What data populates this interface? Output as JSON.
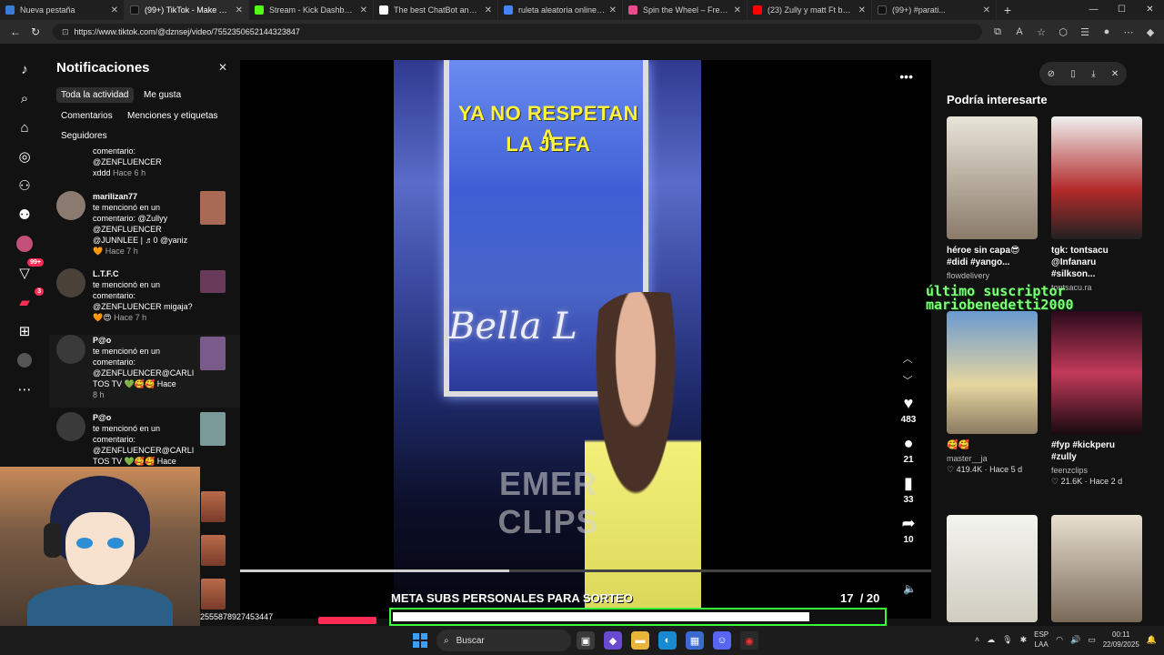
{
  "browser": {
    "tabs": [
      {
        "title": "Nueva pestaña",
        "color": "#3a7bd5",
        "active": false
      },
      {
        "title": "(99+) TikTok - Make Your Day",
        "color": "#111111",
        "active": true
      },
      {
        "title": "Stream - Kick Dashboard",
        "color": "#53fc18",
        "active": false
      },
      {
        "title": "The best ChatBot and Widg...",
        "color": "#ffffff",
        "active": false
      },
      {
        "title": "ruleta aleatoria online - Bú...",
        "color": "#4285f4",
        "active": false
      },
      {
        "title": "Spin the Wheel – Free and...",
        "color": "#e94b8a",
        "active": false
      },
      {
        "title": "(23) Zully y matt Ft baile in...",
        "color": "#ff0000",
        "active": false
      },
      {
        "title": "(99+) #parati...",
        "color": "#111111",
        "active": false
      }
    ],
    "url": "https://www.tiktok.com/@dznsej/video/7552350652144323847"
  },
  "notifications": {
    "title": "Notificaciones",
    "filters": [
      "Toda la actividad",
      "Me gusta",
      "Comentarios",
      "Menciones y etiquetas",
      "Seguidores"
    ],
    "items": [
      {
        "user": "",
        "lines": [
          "comentario:",
          "@ZENFLUENCER",
          "xddd"
        ],
        "time": "Hace 6 h",
        "thumb": "#3a3a3a"
      },
      {
        "user": "marilizan77",
        "lines": [
          "te mencionó en un",
          "comentario: @Zullyy",
          "@ZENFLUENCER",
          "@JUNNLEE | ♬0 @yaniz"
        ],
        "time": "🧡 Hace 7 h",
        "thumb": "#a86a55"
      },
      {
        "user": "L.T.F.C",
        "lines": [
          "te mencionó en un",
          "comentario:",
          "@ZENFLUENCER migaja?",
          "🧡😍"
        ],
        "time": "Hace 7 h",
        "thumb": "#6a3a5a"
      },
      {
        "user": "P@o",
        "lines": [
          "te mencionó en un",
          "comentario:",
          "@ZENFLUENCER@CARLI",
          "TOS TV 💚🥰🥰 Hace"
        ],
        "time": "8 h",
        "thumb": "#7a5a8a"
      },
      {
        "user": "P@o",
        "lines": [
          "te mencionó en un",
          "comentario:",
          "@ZENFLUENCER@CARLI",
          "TOS TV 💚🥰🥰 Hace"
        ],
        "time": "",
        "thumb": "#7a9a9a"
      }
    ]
  },
  "video": {
    "overlay_text_1": "YA NO RESPETAN A",
    "overlay_text_2": "LA JEFA",
    "screen_logo": "Bella L",
    "watermark": "EMER CLIPS",
    "progress": 0.39,
    "likes": "483",
    "comments": "21",
    "saves": "33",
    "shares": "10"
  },
  "recommended": {
    "title": "Podría interesarte",
    "cards": [
      {
        "caption": "héroe sin capa😎 #didi #yango...",
        "author": "flowdelivery",
        "meta": "",
        "img": "#d9d2c4"
      },
      {
        "caption": "tgk: tontsacu @Infanaru #silkson...",
        "author": "tontsacu.ra",
        "meta": "",
        "img": "#e8e8e8"
      },
      {
        "caption": "🥰🥰",
        "author": "master__ja",
        "meta": "♡ 419.4K · Hace 5 d",
        "img": "#7ba3c9"
      },
      {
        "caption": "#fyp #kickperu #zully",
        "author": "feenzclips",
        "meta": "♡ 21.6K · Hace 2 d",
        "img": "#b23a4a"
      },
      {
        "caption": "",
        "author": "",
        "meta": "",
        "img": "#d8d8d0"
      },
      {
        "caption": "",
        "author": "",
        "meta": "",
        "img": "#c8c0b0"
      }
    ]
  },
  "subscriber_overlay": {
    "line1": "último suscriptor",
    "line2": "mariobenedetti2000"
  },
  "stream": {
    "user_id": "2555878927453447",
    "goal_label": "META SUBS PERSONALES PARA SORTEO",
    "goal_current": "17",
    "goal_total": "/ 20",
    "goal_fraction": 0.85
  },
  "taskbar": {
    "search_placeholder": "Buscar",
    "lang_line1": "ESP",
    "lang_line2": "LAA",
    "time": "00:11",
    "date": "22/09/2025"
  },
  "colors": {
    "accent": "#fe2c55",
    "goal_border": "#39ff39",
    "subscriber_text": "#7dff7a"
  }
}
